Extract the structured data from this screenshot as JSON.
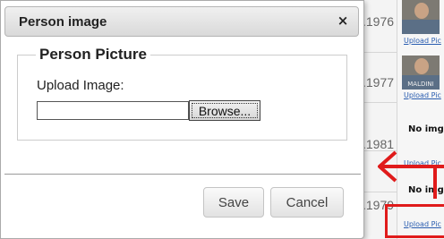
{
  "background": {
    "years": [
      ".1976",
      ".1977",
      ".1981",
      ".1979"
    ],
    "upload_link": "Upload Pic",
    "no_image": "No img",
    "thumb_caption": "MALDINI"
  },
  "modal": {
    "title": "Person image",
    "close_glyph": "×",
    "fieldset_legend": "Person Picture",
    "upload_label": "Upload Image:",
    "file_value": "",
    "browse_label": "Browse...",
    "save_label": "Save",
    "cancel_label": "Cancel"
  },
  "annotation_color": "#e01b1b"
}
